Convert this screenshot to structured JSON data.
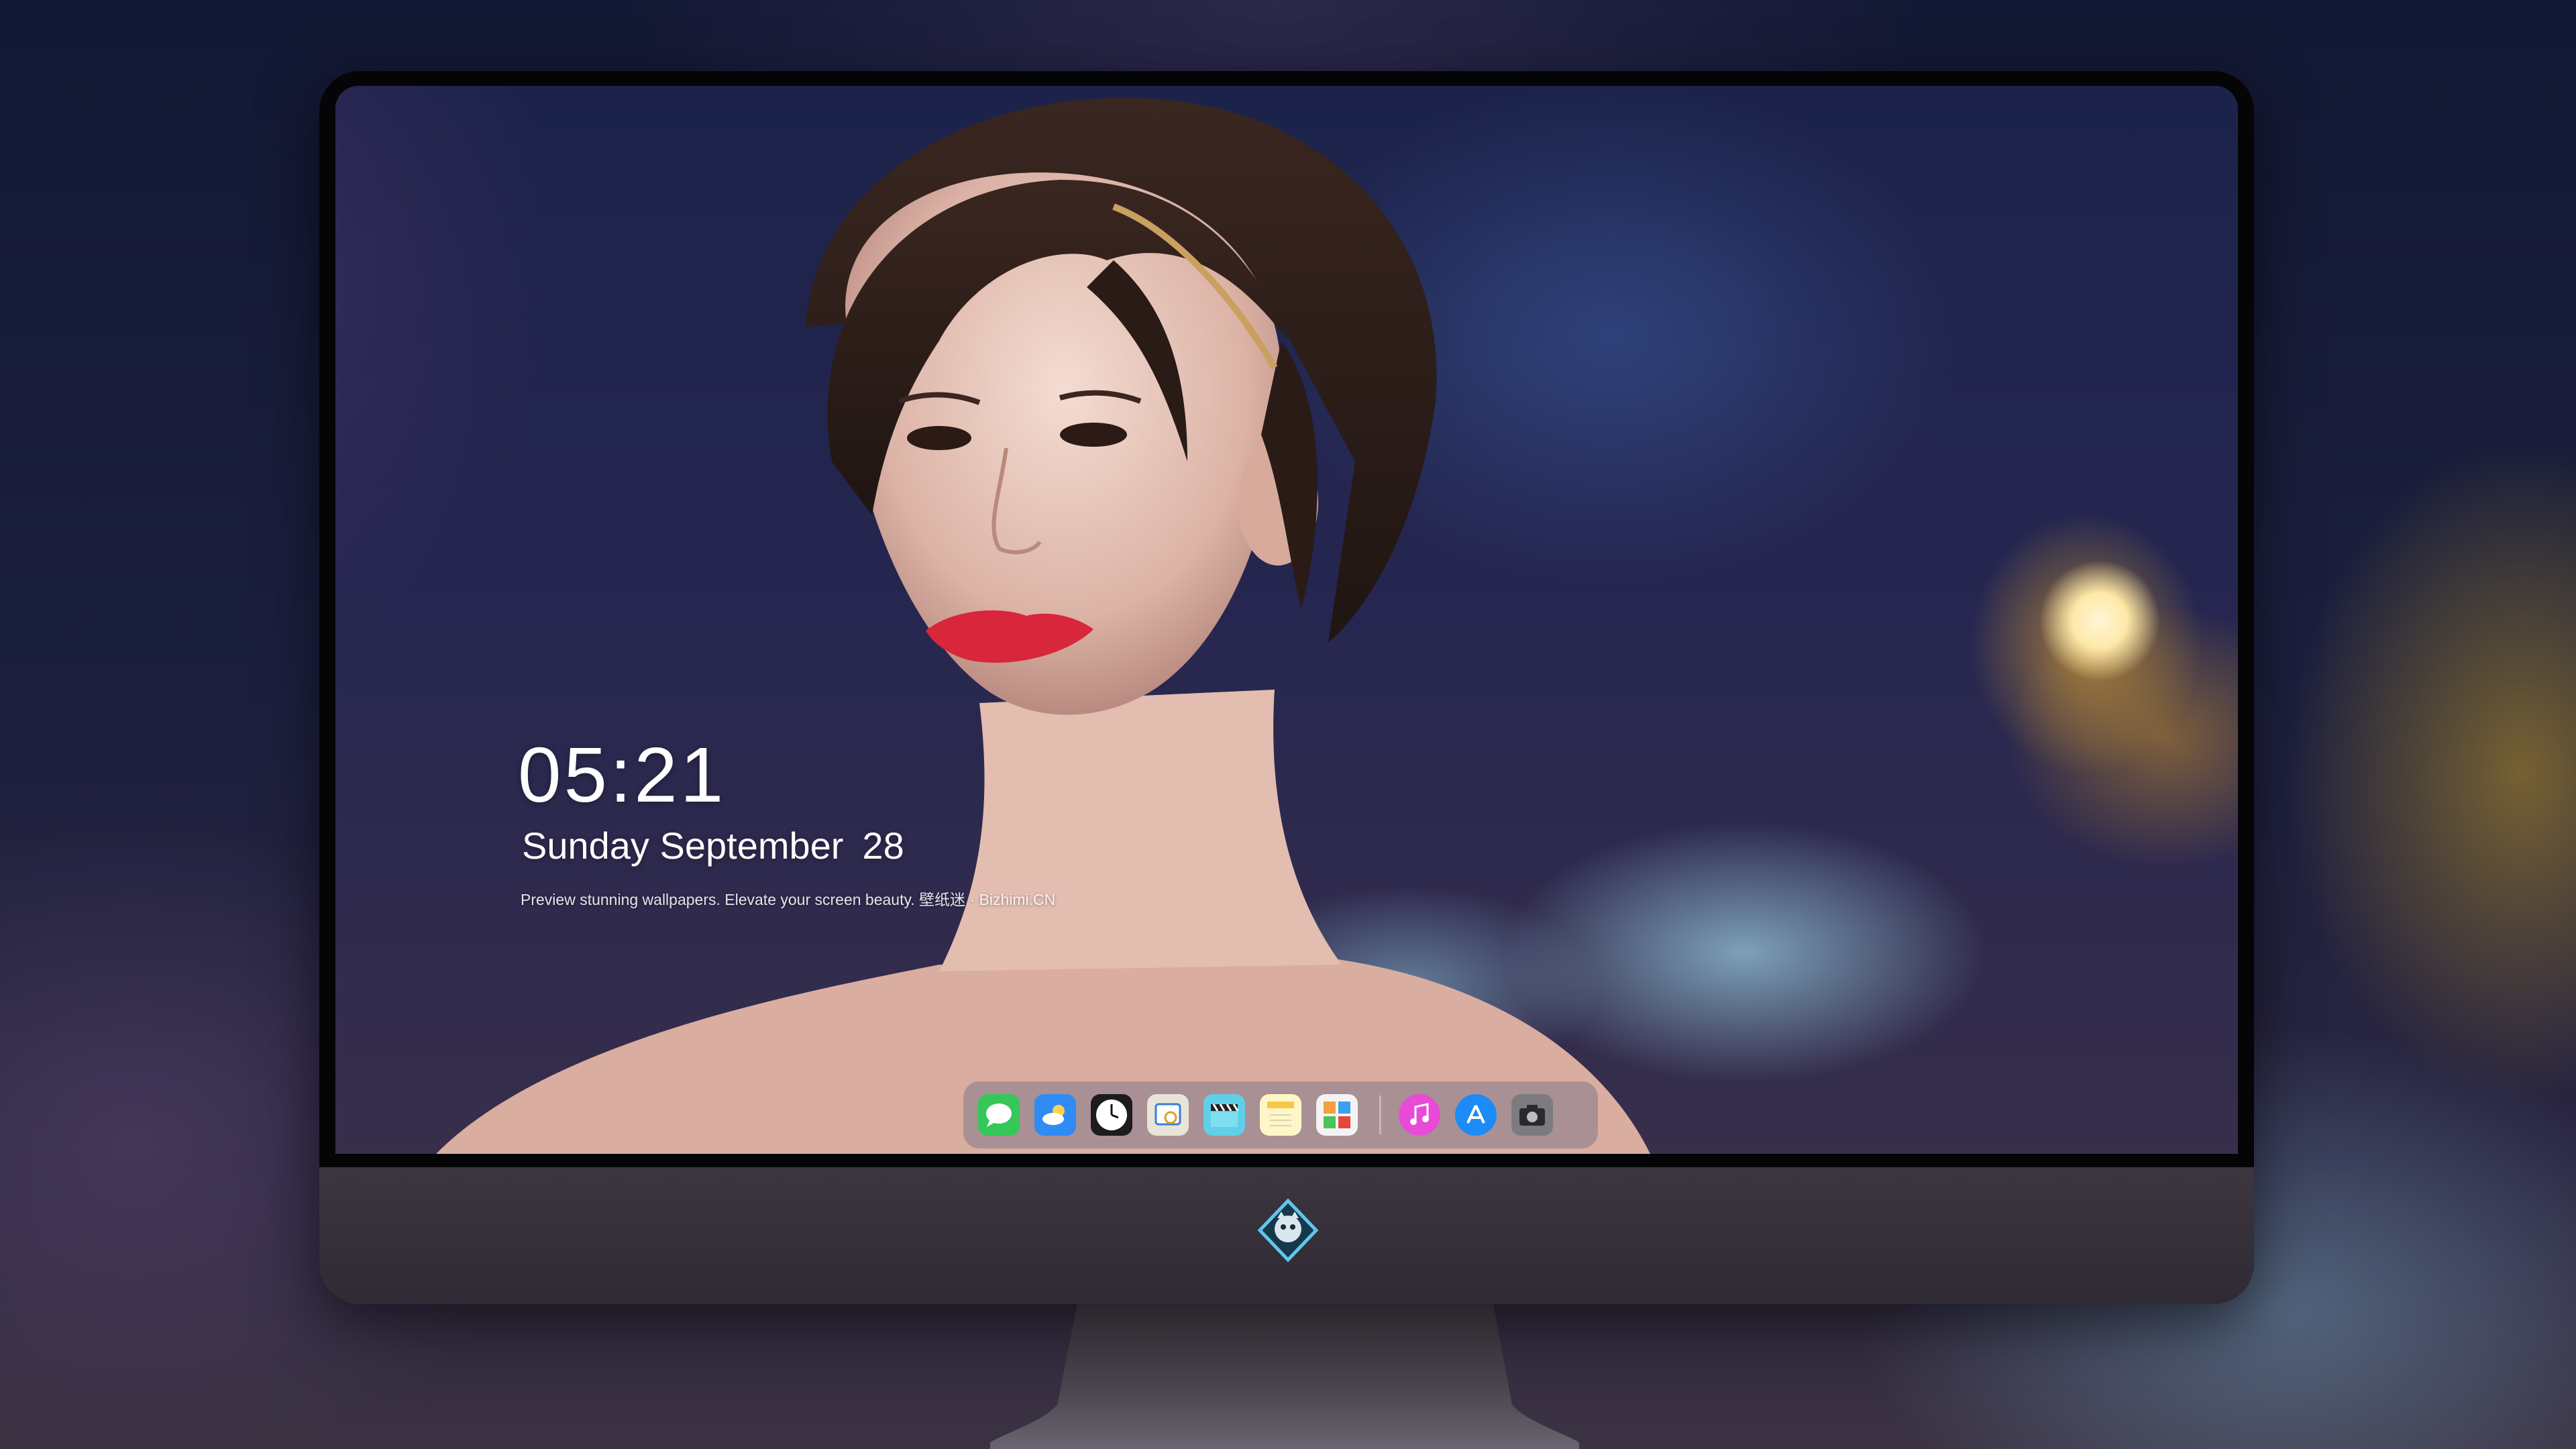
{
  "lock_screen": {
    "time": "05:21",
    "weekday_month": "Sunday September",
    "day": "28",
    "tagline": "Preview stunning wallpapers. Elevate your screen beauty. 壁纸迷 · Bizhimi.CN"
  },
  "dock": {
    "apps": [
      {
        "name": "messages-icon",
        "color": "#35c759"
      },
      {
        "name": "weather-icon",
        "color": "#2f8cf5"
      },
      {
        "name": "clock-icon",
        "color": "#1c1c1e"
      },
      {
        "name": "preview-icon",
        "color": "#e9e4d8"
      },
      {
        "name": "video-editor-icon",
        "color": "#5fd0e8"
      },
      {
        "name": "notes-icon",
        "color": "#fff6c8"
      },
      {
        "name": "photos-grid-icon",
        "color": "#f0a13a"
      },
      {
        "name": "music-icon",
        "color": "#e94ad7"
      },
      {
        "name": "app-store-icon",
        "color": "#1c8bf7"
      },
      {
        "name": "camera-icon",
        "color": "#7c7c80"
      }
    ]
  },
  "colors": {
    "monitor_bezel": "#050507",
    "monitor_chin": "#38323c",
    "backdrop": "#1b1f3e"
  }
}
